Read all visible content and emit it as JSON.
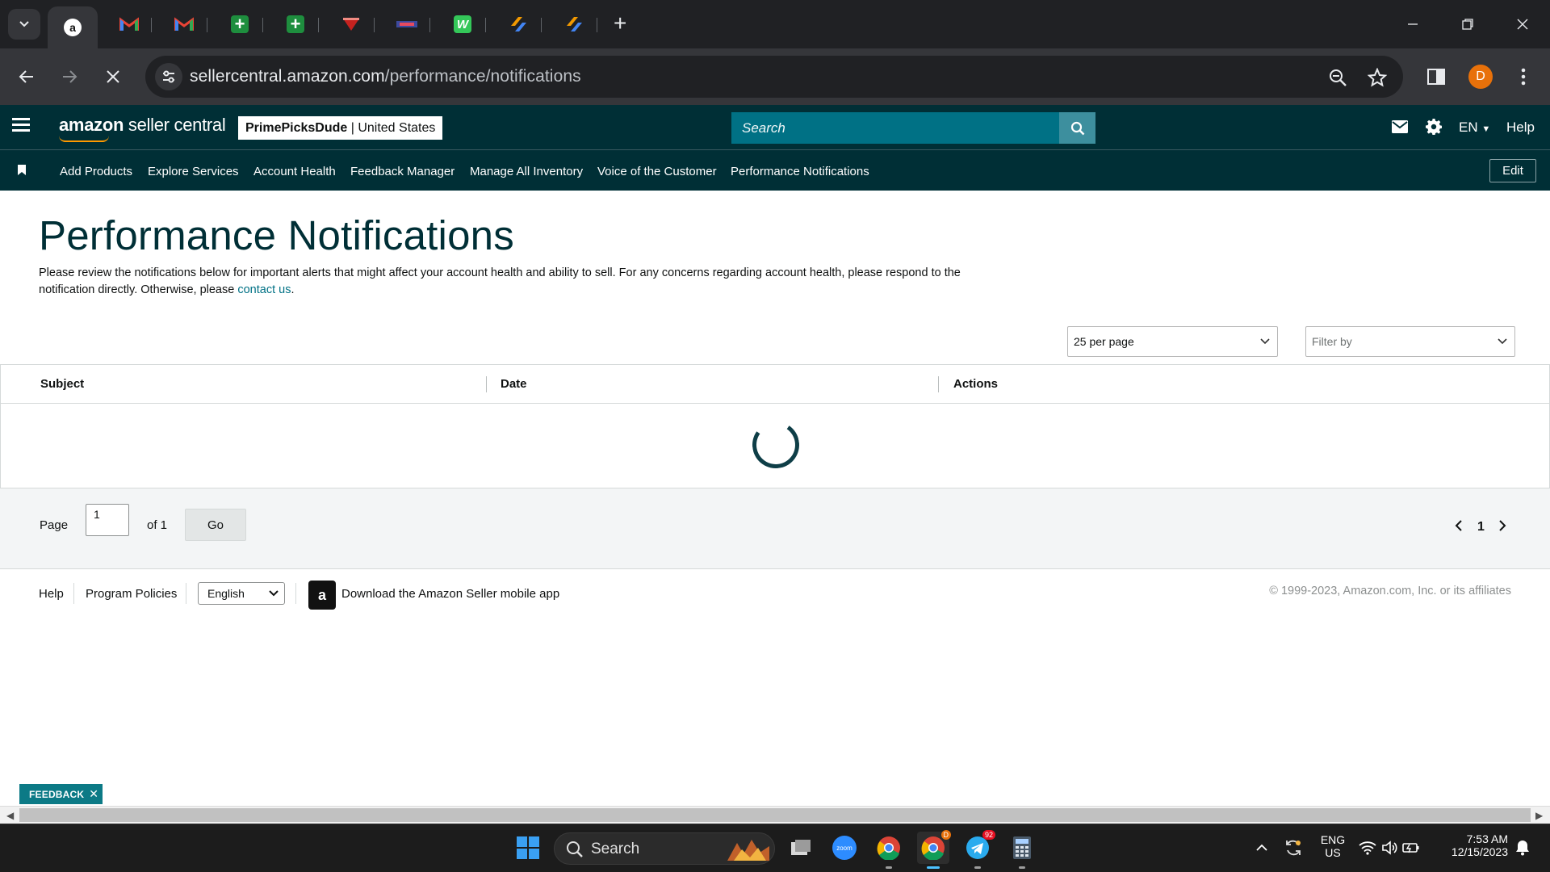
{
  "browser": {
    "tabs": [
      {
        "icon": "amazon-favicon",
        "active": true
      },
      {
        "icon": "gmail-favicon",
        "active": false
      },
      {
        "icon": "gmail-favicon",
        "active": false
      },
      {
        "icon": "sheets-favicon",
        "active": false
      },
      {
        "icon": "sheets-favicon",
        "active": false
      },
      {
        "icon": "red-logo-favicon",
        "active": false
      },
      {
        "icon": "banner-favicon",
        "active": false
      },
      {
        "icon": "w-green-favicon",
        "active": false
      },
      {
        "icon": "striped-orange-favicon",
        "active": false
      },
      {
        "icon": "striped-orange-favicon",
        "active": false
      }
    ],
    "url_host": "sellercentral.amazon.com",
    "url_path": "/performance/notifications",
    "profile_initial": "D"
  },
  "header": {
    "logo_amazon": "amazon",
    "logo_rest": " seller central",
    "store_name": "PrimePicksDude",
    "store_divider": " | ",
    "store_region": "United States",
    "search_placeholder": "Search",
    "language": "EN",
    "help": "Help"
  },
  "nav": {
    "links": [
      "Add Products",
      "Explore Services",
      "Account Health",
      "Feedback Manager",
      "Manage All Inventory",
      "Voice of the Customer",
      "Performance Notifications"
    ],
    "edit_label": "Edit"
  },
  "main": {
    "title": "Performance Notifications",
    "description": "Please review the notifications below for important alerts that might affect your account health and ability to sell. For any concerns regarding account health, please respond to the notification directly. Otherwise, please ",
    "contact_link": "contact us",
    "description_end": ".",
    "per_page": "25 per page",
    "filter_placeholder": "Filter by",
    "columns": [
      "Subject",
      "Date",
      "Actions"
    ]
  },
  "pager": {
    "page_label": "Page",
    "page_value": "1",
    "of_label": "of 1",
    "go_label": "Go",
    "current_page": "1"
  },
  "footer": {
    "help": "Help",
    "program_policies": "Program Policies",
    "language": "English",
    "app_text": "Download the Amazon Seller mobile app",
    "copyright": "© 1999-2023, Amazon.com, Inc. or its affiliates"
  },
  "feedback": {
    "label": "FEEDBACK"
  },
  "taskbar": {
    "search_label": "Search",
    "lang_top": "ENG",
    "lang_bottom": "US",
    "time": "7:53 AM",
    "date": "12/15/2023",
    "chrome_badge": "D",
    "telegram_badge": "92"
  },
  "colors": {
    "header_bg": "#002f36",
    "search_bg": "#007185",
    "accent_link": "#007185",
    "feedback_bg": "#0c7a86"
  }
}
